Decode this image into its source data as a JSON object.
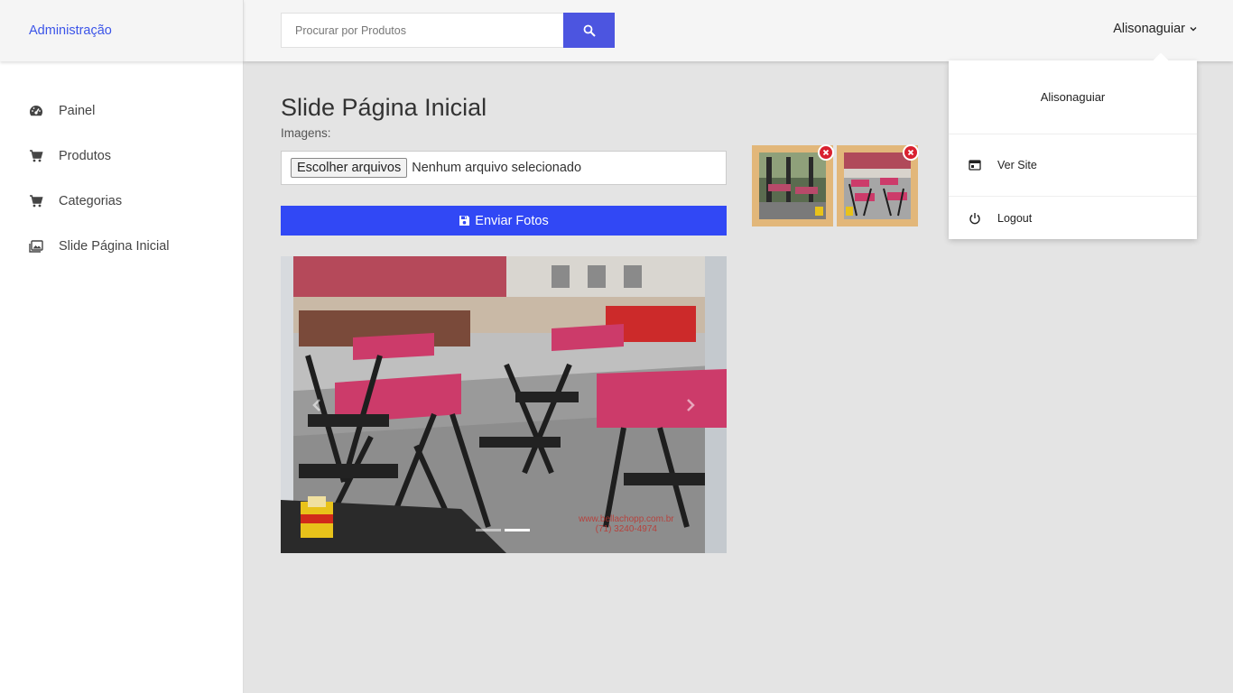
{
  "brand": {
    "title": "Administração"
  },
  "sidebar": {
    "items": [
      {
        "label": "Painel",
        "icon": "dashboard-icon"
      },
      {
        "label": "Produtos",
        "icon": "cart-icon"
      },
      {
        "label": "Categorias",
        "icon": "cart-icon"
      },
      {
        "label": "Slide Página Inicial",
        "icon": "images-icon"
      }
    ]
  },
  "header": {
    "search_placeholder": "Procurar por Produtos",
    "user_name": "Alisonaguiar"
  },
  "dropdown": {
    "user_name": "Alisonaguiar",
    "ver_site": "Ver Site",
    "logout": "Logout"
  },
  "main": {
    "title": "Slide Página Inicial",
    "images_label": "Imagens:",
    "file_button": "Escolher arquivos",
    "file_status": "Nenhum arquivo selecionado",
    "send_button": "Enviar Fotos"
  },
  "carousel": {
    "slide_count": 2,
    "active_index": 1,
    "watermark_line1": "www.bellachopp.com.br",
    "watermark_line2": "(71) 3240-4974"
  },
  "thumbnails": [
    {
      "alt": "slide-image-1"
    },
    {
      "alt": "slide-image-2"
    }
  ],
  "colors": {
    "accent": "#3148f5",
    "brand_link": "#3b54e8",
    "search_button": "#4c55e0",
    "thumb_frame": "#e2b77a",
    "delete_badge": "#d9202f"
  }
}
